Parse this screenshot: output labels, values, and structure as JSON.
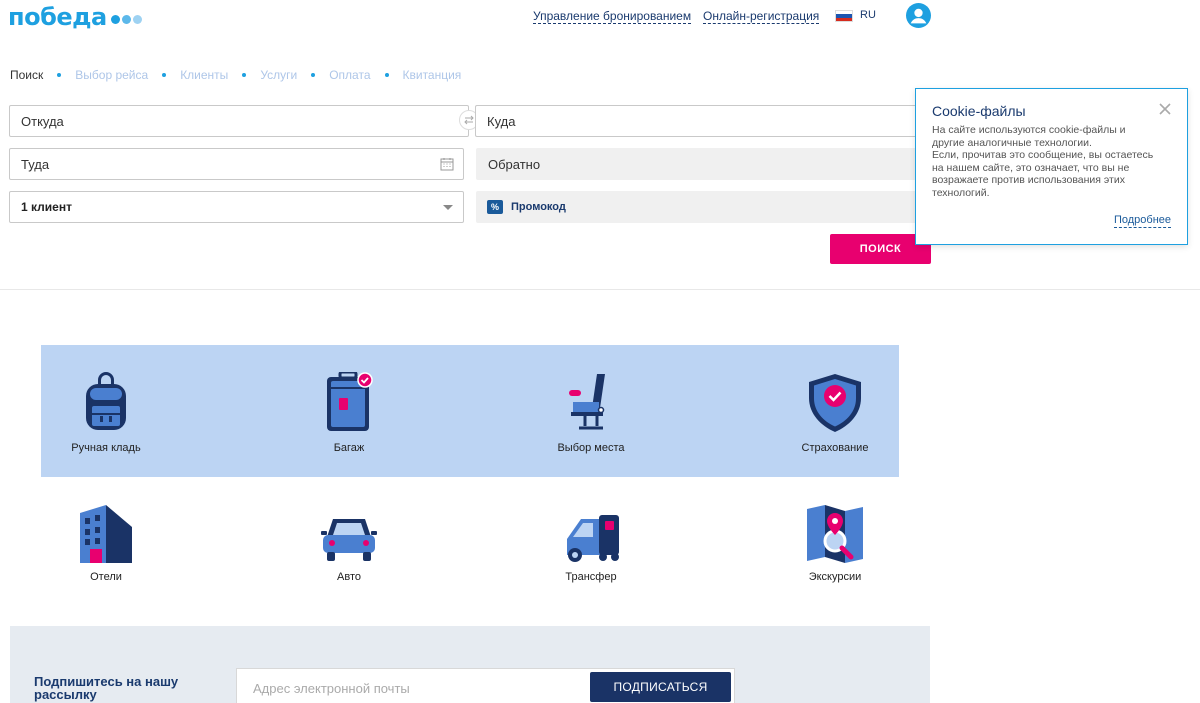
{
  "header": {
    "logo": "победа",
    "manage_booking": "Управление бронированием",
    "online_checkin": "Онлайн-регистрация",
    "language": "RU"
  },
  "steps": [
    "Поиск",
    "Выбор рейса",
    "Клиенты",
    "Услуги",
    "Оплата",
    "Квитанция"
  ],
  "form": {
    "from_placeholder": "Откуда",
    "to_placeholder": "Куда",
    "depart_placeholder": "Туда",
    "return_placeholder": "Обратно",
    "passengers_value": "1 клиент",
    "promo_badge": "%",
    "promo_label": "Промокод",
    "search_button": "ПОИСК"
  },
  "cookie": {
    "title": "Cookie-файлы",
    "text": "На сайте используются cookie-файлы и\nдругие аналогичные технологии.\nЕсли, прочитав это сообщение, вы остаетесь\nна нашем сайте, это означает, что вы не\nвозражаете против использования этих\nтехнологий.",
    "more_link": "Подробнее"
  },
  "services": [
    {
      "label": "Ручная кладь",
      "icon": "backpack-icon"
    },
    {
      "label": "Багаж",
      "icon": "suitcase-icon"
    },
    {
      "label": "Выбор места",
      "icon": "seat-icon"
    },
    {
      "label": "Страхование",
      "icon": "shield-icon"
    },
    {
      "label": "Отели",
      "icon": "hotel-icon"
    },
    {
      "label": "Авто",
      "icon": "car-icon"
    },
    {
      "label": "Трансфер",
      "icon": "transfer-icon"
    },
    {
      "label": "Экскурсии",
      "icon": "map-icon"
    }
  ],
  "newsletter": {
    "title": "Подпишитесь на нашу рассылку",
    "email_placeholder": "Адрес электронной почты",
    "subscribe_button": "ПОДПИСАТЬСЯ"
  },
  "colors": {
    "brand_blue": "#1ea0e0",
    "navy": "#1a3a6e",
    "accent_pink": "#e8006f",
    "service_band": "#bcd4f3"
  }
}
